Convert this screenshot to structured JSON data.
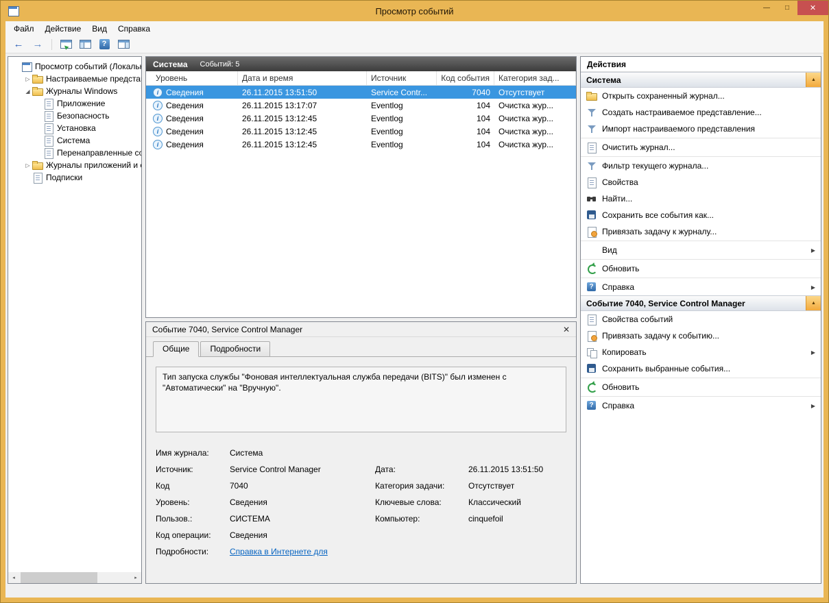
{
  "window": {
    "title": "Просмотр событий",
    "controls": {
      "minimize": "—",
      "maximize": "□",
      "close": "✕"
    }
  },
  "colors": {
    "chrome_gold": "#E9B654",
    "close_red": "#C75050",
    "selection_blue": "#3A96E0",
    "link_blue": "#0563C1",
    "section_chevron_amber": "#F3A93B"
  },
  "menu": {
    "items": [
      "Файл",
      "Действие",
      "Вид",
      "Справка"
    ]
  },
  "toolbar": {
    "buttons": [
      "back",
      "forward",
      "export-list",
      "console-tree",
      "help",
      "action-pane"
    ]
  },
  "tree": {
    "items": [
      {
        "label": "Просмотр событий (Локальны",
        "icon": "event-viewer",
        "expander": ""
      },
      {
        "label": "Настраиваемые представле",
        "icon": "folder",
        "expander": "▷"
      },
      {
        "label": "Журналы Windows",
        "icon": "folder",
        "expander": "◢"
      },
      {
        "label": "Приложение",
        "icon": "log",
        "expander": ""
      },
      {
        "label": "Безопасность",
        "icon": "log",
        "expander": ""
      },
      {
        "label": "Установка",
        "icon": "log",
        "expander": ""
      },
      {
        "label": "Система",
        "icon": "log",
        "expander": ""
      },
      {
        "label": "Перенаправленные соб",
        "icon": "log",
        "expander": ""
      },
      {
        "label": "Журналы приложений и сл",
        "icon": "folder",
        "expander": "▷"
      },
      {
        "label": "Подписки",
        "icon": "subscriptions",
        "expander": ""
      }
    ]
  },
  "list": {
    "title": "Система",
    "count": "Событий: 5",
    "columns": [
      "Уровень",
      "Дата и время",
      "Источник",
      "Код события",
      "Категория зад..."
    ],
    "rows": [
      {
        "level": "Сведения",
        "datetime": "26.11.2015 13:51:50",
        "source": "Service Contr...",
        "code": "7040",
        "category": "Отсутствует",
        "selected": true
      },
      {
        "level": "Сведения",
        "datetime": "26.11.2015 13:17:07",
        "source": "Eventlog",
        "code": "104",
        "category": "Очистка жур...",
        "selected": false
      },
      {
        "level": "Сведения",
        "datetime": "26.11.2015 13:12:45",
        "source": "Eventlog",
        "code": "104",
        "category": "Очистка жур...",
        "selected": false
      },
      {
        "level": "Сведения",
        "datetime": "26.11.2015 13:12:45",
        "source": "Eventlog",
        "code": "104",
        "category": "Очистка жур...",
        "selected": false
      },
      {
        "level": "Сведения",
        "datetime": "26.11.2015 13:12:45",
        "source": "Eventlog",
        "code": "104",
        "category": "Очистка жур...",
        "selected": false
      }
    ]
  },
  "preview": {
    "title": "Событие 7040, Service Control Manager",
    "close_glyph": "✕",
    "tabs": [
      "Общие",
      "Подробности"
    ],
    "message": "Тип запуска службы \"Фоновая интеллектуальная служба передачи (BITS)\" был изменен с \"Автоматически\" на \"Вручную\".",
    "fields": {
      "log_name_label": "Имя журнала:",
      "log_name": "Система",
      "source_label": "Источник:",
      "source": "Service Control Manager",
      "date_label": "Дата:",
      "date": "26.11.2015 13:51:50",
      "code_label": "Код",
      "code": "7040",
      "task_category_label": "Категория задачи:",
      "task_category": "Отсутствует",
      "level_label": "Уровень:",
      "level": "Сведения",
      "keywords_label": "Ключевые слова:",
      "keywords": "Классический",
      "user_label": "Пользов.:",
      "user": "СИСТЕМА",
      "computer_label": "Компьютер:",
      "computer": "cinquefoil",
      "opcode_label": "Код операции:",
      "opcode": "Сведения",
      "details_label": "Подробности:",
      "details_link": "Справка в Интернете для "
    }
  },
  "actions": {
    "title": "Действия",
    "sections": [
      {
        "title": "Система",
        "items": [
          {
            "label": "Открыть сохраненный журнал...",
            "icon": "open-folder"
          },
          {
            "label": "Создать настраиваемое представление...",
            "icon": "funnel"
          },
          {
            "label": "Импорт настраиваемого представления",
            "icon": "funnel"
          },
          {
            "label": "Очистить журнал...",
            "icon": "page"
          },
          {
            "label": "Фильтр текущего журнала...",
            "icon": "funnel"
          },
          {
            "label": "Свойства",
            "icon": "page"
          },
          {
            "label": "Найти...",
            "icon": "binoculars"
          },
          {
            "label": "Сохранить все события как...",
            "icon": "save"
          },
          {
            "label": "Привязать задачу к журналу...",
            "icon": "task"
          },
          {
            "label": "Вид",
            "icon": "",
            "submenu": true
          },
          {
            "label": "Обновить",
            "icon": "refresh"
          },
          {
            "label": "Справка",
            "icon": "help",
            "submenu": true
          }
        ]
      },
      {
        "title": "Событие 7040, Service Control Manager",
        "items": [
          {
            "label": "Свойства событий",
            "icon": "page"
          },
          {
            "label": "Привязать задачу к событию...",
            "icon": "task"
          },
          {
            "label": "Копировать",
            "icon": "copy",
            "submenu": true
          },
          {
            "label": "Сохранить выбранные события...",
            "icon": "save"
          },
          {
            "label": "Обновить",
            "icon": "refresh"
          },
          {
            "label": "Справка",
            "icon": "help",
            "submenu": true
          }
        ]
      }
    ]
  }
}
